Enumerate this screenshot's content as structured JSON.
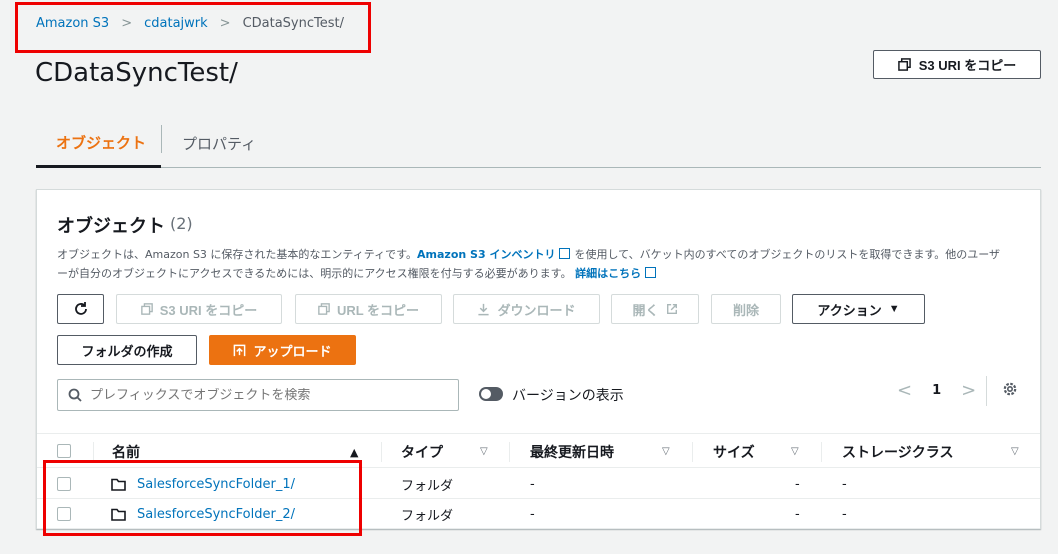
{
  "breadcrumb": {
    "items": [
      "Amazon S3",
      "cdatajwrk",
      "CDataSyncTest/"
    ]
  },
  "page_title": "CDataSyncTest/",
  "header": {
    "copy_uri_label": "S3 URI をコピー"
  },
  "tabs": [
    {
      "label": "オブジェクト",
      "active": true
    },
    {
      "label": "プロパティ",
      "active": false
    }
  ],
  "panel": {
    "title": "オブジェクト",
    "count": "(2)",
    "desc_1": "オブジェクトは、Amazon S3 に保存された基本的なエンティティです。",
    "desc_link_1": "Amazon S3 インベントリ",
    "desc_2": "を使用して、バケット内のすべてのオブジェクトのリストを取得できます。他のユーザーが自分のオブジェクトにアクセスできるためには、明示的にアクセス権限を付与する必要があります。",
    "desc_link_2": "詳細はこちら"
  },
  "toolbar": {
    "copy_s3_uri": "S3 URI をコピー",
    "copy_url": "URL をコピー",
    "download": "ダウンロード",
    "open": "開く",
    "delete": "削除",
    "actions": "アクション",
    "create_folder": "フォルダの作成",
    "upload": "アップロード"
  },
  "search": {
    "placeholder": "プレフィックスでオブジェクトを検索"
  },
  "versions_label": "バージョンの表示",
  "pager": {
    "page": "1"
  },
  "table": {
    "columns": [
      "名前",
      "タイプ",
      "最終更新日時",
      "サイズ",
      "ストレージクラス"
    ],
    "rows": [
      {
        "name": "SalesforceSyncFolder_1/",
        "type": "フォルダ",
        "modified": "-",
        "size": "-",
        "storage": "-"
      },
      {
        "name": "SalesforceSyncFolder_2/",
        "type": "フォルダ",
        "modified": "-",
        "size": "-",
        "storage": "-"
      }
    ]
  },
  "colors": {
    "accent": "#ec7211",
    "link": "#0073bb",
    "highlight": "#ee0000"
  }
}
